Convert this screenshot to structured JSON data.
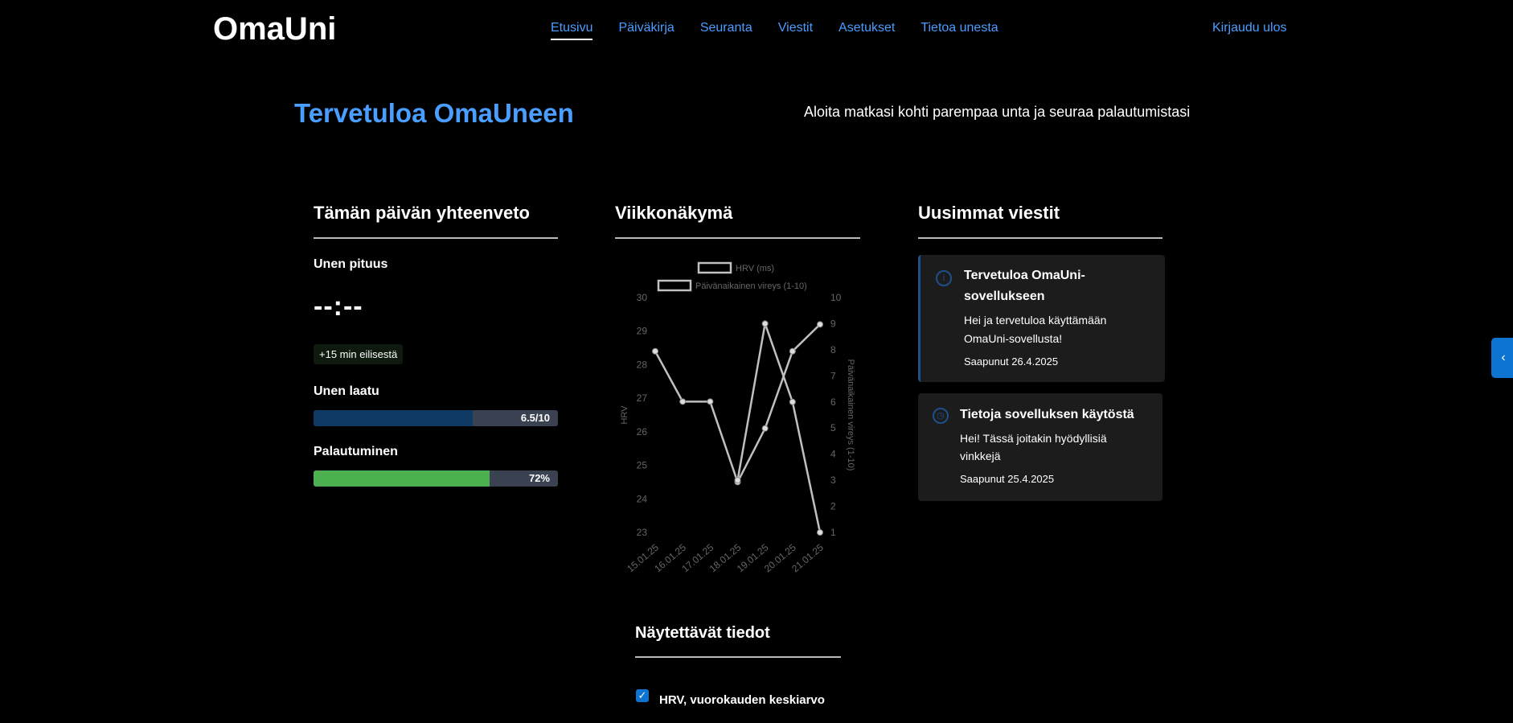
{
  "app": {
    "logo": "OmaUni"
  },
  "nav": {
    "items": [
      "Etusivu",
      "Päiväkirja",
      "Seuranta",
      "Viestit",
      "Asetukset",
      "Tietoa unesta"
    ],
    "logout": "Kirjaudu ulos"
  },
  "hero": {
    "title": "Tervetuloa OmaUneen",
    "subtitle": "Aloita matkasi kohti parempaa unta ja seuraa palautumistasi"
  },
  "summary": {
    "heading": "Tämän päivän yhteenveto",
    "sleep_length_label": "Unen pituus",
    "sleep_length_value": "--:--",
    "sleep_change": "+15 min eilisestä",
    "quality_label": "Unen laatu",
    "quality_text": "6.5/10",
    "quality_fraction": 0.65,
    "quality_color": "#0f3a66",
    "recovery_label": "Palautuminen",
    "recovery_text": "72%",
    "recovery_fraction": 0.72,
    "recovery_color": "#4caf50"
  },
  "weekly": {
    "heading": "Viikkonäkymä"
  },
  "chart_data": {
    "type": "line",
    "categories": [
      "15.01.25",
      "16.01.25",
      "17.01.25",
      "18.01.25",
      "19.01.25",
      "20.01.25",
      "21.01.25"
    ],
    "series": [
      {
        "name": "HRV (ms)",
        "axis": "left",
        "values": [
          28.4,
          26.9,
          26.9,
          24.5,
          26.1,
          28.4,
          29.2
        ]
      },
      {
        "name": "Päivänaikainen vireys (1-10)",
        "axis": "right",
        "values": [
          null,
          null,
          null,
          3,
          9,
          6,
          1
        ]
      }
    ],
    "ylabel": "HRV",
    "y2label": "Päivänaikainen vireys (1-10)",
    "ylim": [
      23,
      30
    ],
    "y2lim": [
      1,
      10
    ],
    "yticks": [
      "23",
      "24",
      "25",
      "26",
      "27",
      "28",
      "29",
      "30"
    ],
    "y2ticks": [
      "1",
      "2",
      "3",
      "4",
      "5",
      "6",
      "7",
      "8",
      "9",
      "10"
    ],
    "legend": "top",
    "line_color": "#c0c0c0"
  },
  "messages": {
    "heading": "Uusimmat viestit",
    "items": [
      {
        "icon": "info-icon",
        "title_line1": "Tervetuloa OmaUni-",
        "title_line2": "sovellukseen",
        "body_line1": "Hei ja tervetuloa käyttämään",
        "body_line2": "OmaUni-sovellusta!",
        "date": "Saapunut 26.4.2025"
      },
      {
        "icon": "clock-icon",
        "title_line1": "Tietoja sovelluksen käytöstä",
        "body_line1": "Hei! Tässä joitakin hyödyllisiä",
        "body_line2": "vinkkejä",
        "date": "Saapunut 25.4.2025"
      }
    ]
  },
  "display_settings": {
    "heading": "Näytettävät tiedot",
    "options": [
      {
        "label": "HRV, vuorokauden keskiarvo",
        "checked": true
      }
    ]
  },
  "side_toggle": {
    "icon": "chevron-left-icon",
    "glyph": "‹"
  }
}
